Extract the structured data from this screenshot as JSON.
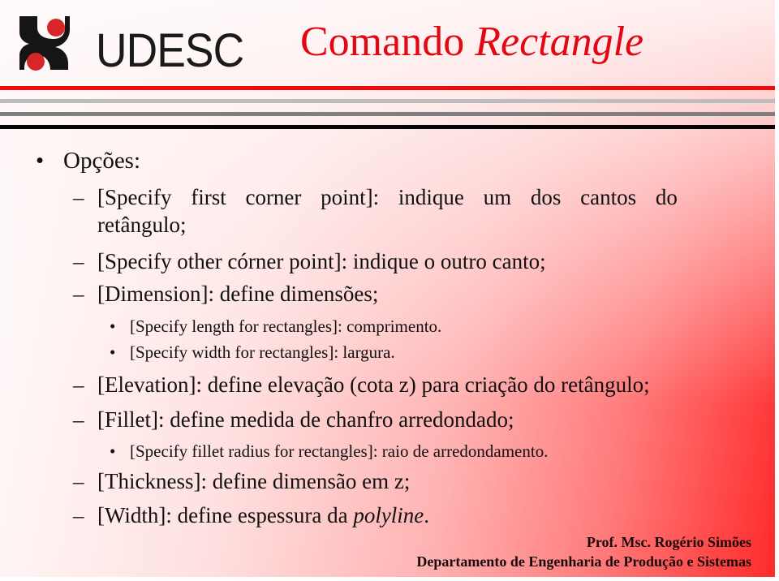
{
  "header": {
    "logo_text": "UDESC",
    "title_plain": "Comando ",
    "title_italic": "Rectangle"
  },
  "colors": {
    "title": "#e30613",
    "rule_red": "#f20a0a",
    "logo_red": "#d7262a"
  },
  "body": {
    "heading_bullet": "•",
    "heading": "Opções:",
    "dash": "–",
    "dot": "•",
    "items": [
      {
        "level": 2,
        "text_line1": "[Specify first corner point]: indique um dos cantos do",
        "text_line2": "retângulo;"
      },
      {
        "level": 2,
        "text": "[Specify other córner point]: indique o outro canto;"
      },
      {
        "level": 2,
        "text": "[Dimension]: define dimensões;"
      },
      {
        "level": 3,
        "text": "[Specify length for rectangles]: comprimento."
      },
      {
        "level": 3,
        "text": "[Specify width for rectangles]: largura."
      },
      {
        "level": 2,
        "text": "[Elevation]: define elevação (cota z) para criação do retângulo;"
      },
      {
        "level": 2,
        "text": "[Fillet]: define medida de chanfro arredondado;"
      },
      {
        "level": 3,
        "text": "[Specify fillet radius for rectangles]: raio de arredondamento."
      },
      {
        "level": 2,
        "text": "[Thickness]: define dimensão em z;"
      },
      {
        "level": 2,
        "text_plain": "[Width]: define espessura da ",
        "text_italic": "polyline",
        "text_end": "."
      }
    ]
  },
  "footer": {
    "author": "Prof. Msc. Rogério Simões",
    "department": "Departamento de Engenharia de Produção e Sistemas"
  }
}
